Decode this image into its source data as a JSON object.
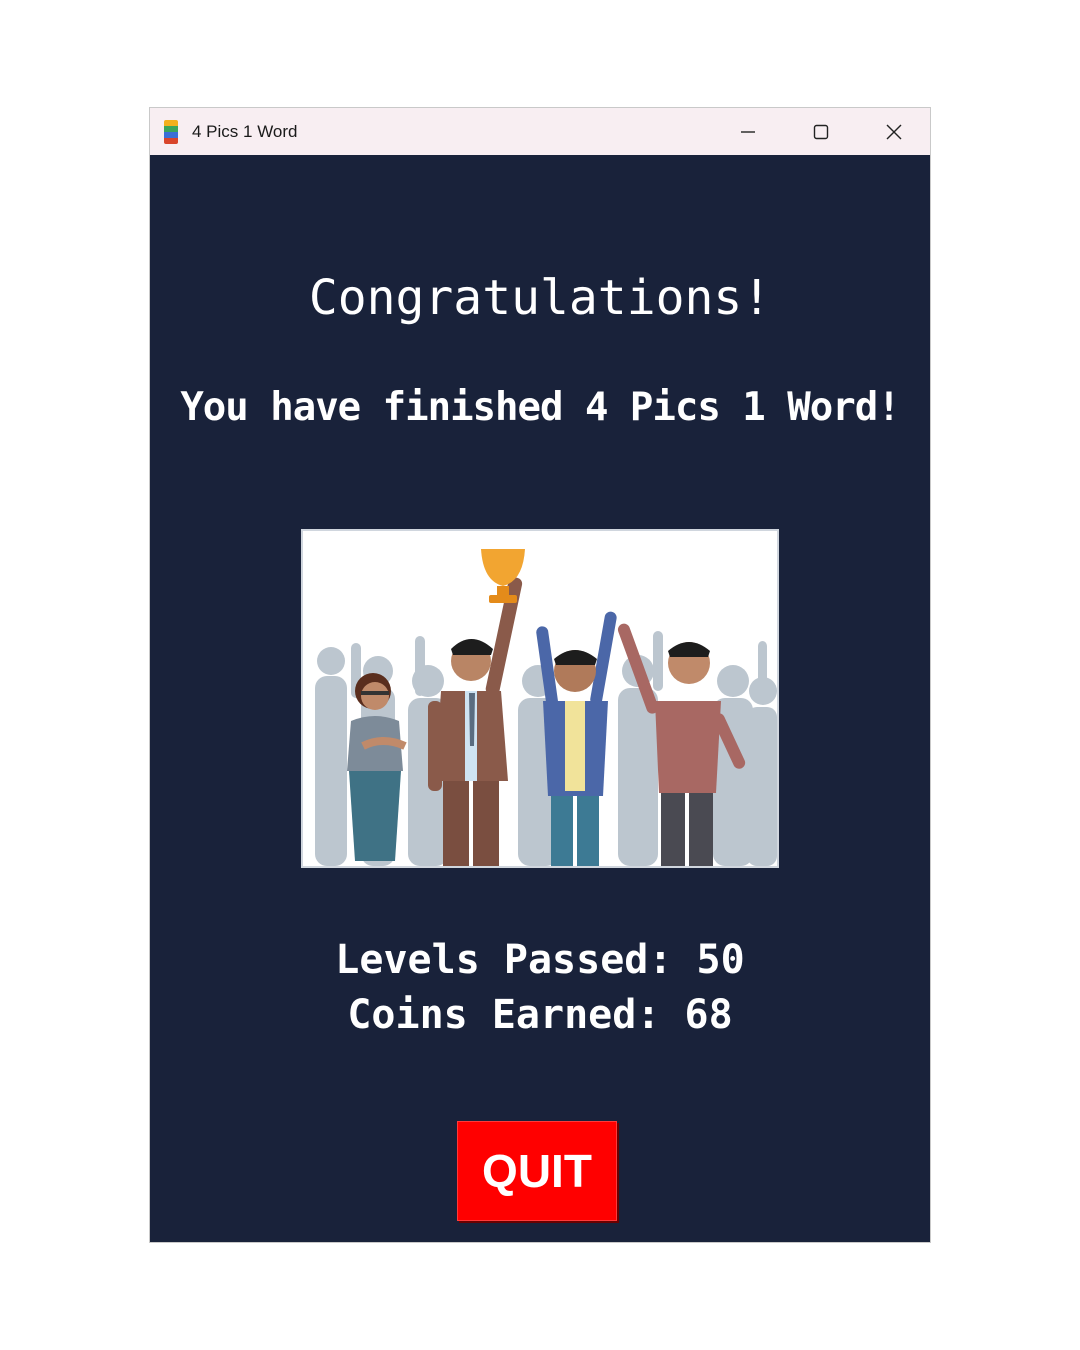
{
  "window": {
    "title": "4 Pics 1 Word",
    "icon": "app-icon",
    "controls": [
      "minimize-icon",
      "maximize-icon",
      "close-icon"
    ]
  },
  "main": {
    "heading": "Congratulations!",
    "subtitle": "You have finished 4 Pics 1 Word!",
    "image": "celebration-illustration",
    "levels_passed": "Levels Passed: 50",
    "coins_earned": "Coins Earned: 68",
    "quit_label": "QUIT"
  },
  "colors": {
    "background": "#19223a",
    "titlebar": "#f8eef2",
    "quit_button": "#ff0000",
    "text": "#ffffff"
  }
}
